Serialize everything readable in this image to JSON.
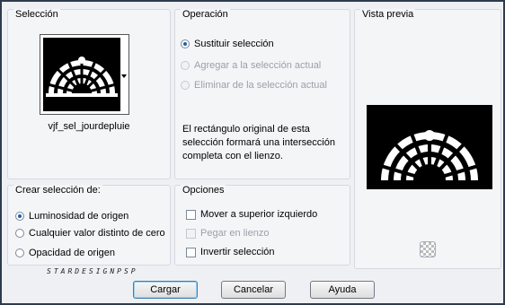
{
  "selection": {
    "legend": "Selección",
    "filename": "vjf_sel_jourdepluie"
  },
  "operation": {
    "legend": "Operación",
    "options": [
      {
        "label": "Sustituir selección",
        "selected": true,
        "enabled": true
      },
      {
        "label": "Agregar a la selección actual",
        "selected": false,
        "enabled": false
      },
      {
        "label": "Eliminar de la selección actual",
        "selected": false,
        "enabled": false
      }
    ],
    "description": [
      "El rectángulo original de esta",
      "selección formará una intersección",
      "completa con el lienzo."
    ]
  },
  "preview": {
    "legend": "Vista previa"
  },
  "create": {
    "legend": "Crear selección de:",
    "options": [
      {
        "label": "Luminosidad de origen",
        "selected": true
      },
      {
        "label": "Cualquier valor distinto de cero",
        "selected": false
      },
      {
        "label": "Opacidad de origen",
        "selected": false
      }
    ]
  },
  "options_group": {
    "legend": "Opciones",
    "items": [
      {
        "label": "Mover a superior izquierdo",
        "enabled": true
      },
      {
        "label": "Pegar en lienzo",
        "enabled": false
      },
      {
        "label": "Invertir selección",
        "enabled": true
      }
    ]
  },
  "watermark": "STARDESIGNPSP",
  "buttons": {
    "load": "Cargar",
    "cancel": "Cancelar",
    "help": "Ayuda"
  }
}
